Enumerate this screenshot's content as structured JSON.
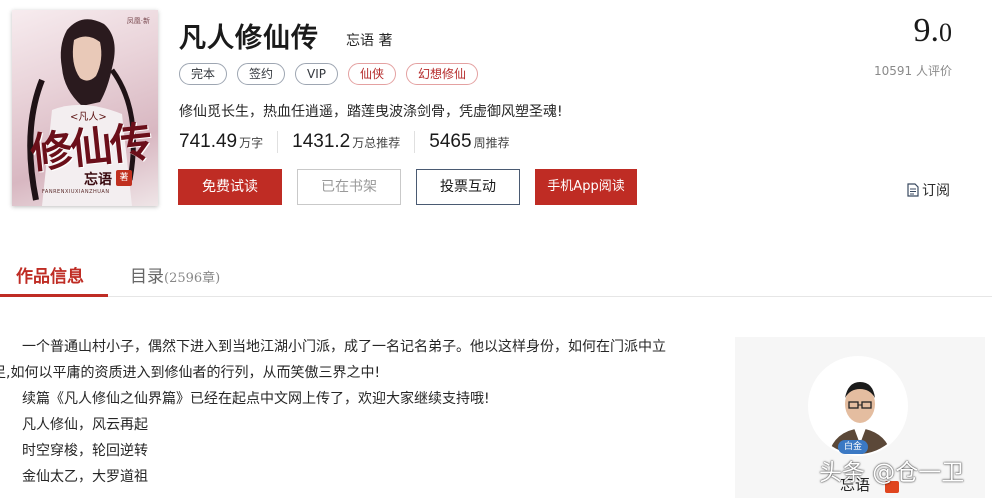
{
  "cover": {
    "title_art": "修仙传",
    "title_sub": "<凡人>",
    "author_art": "忘语",
    "seal": "著",
    "pinyin": "FANRENXIUXIANZHUAN",
    "corner_mark": "凤凰·新"
  },
  "book": {
    "title": "凡人修仙传",
    "author": "忘语 著",
    "tags": [
      "完本",
      "签约",
      "VIP",
      "仙侠",
      "幻想修仙"
    ],
    "intro": "修仙觅长生，热血任逍遥，踏莲曳波涤剑骨，凭虚御风塑圣魂!",
    "stats": [
      {
        "num": "741.49",
        "unit": "万字"
      },
      {
        "num": "1431.2",
        "unit": "万总推荐"
      },
      {
        "num": "5465",
        "unit": "周推荐"
      }
    ]
  },
  "buttons": {
    "read": "免费试读",
    "shelf": "已在书架",
    "vote": "投票互动",
    "app": "手机App阅读",
    "subscribe": "订阅"
  },
  "rating": {
    "score_int": "9.",
    "score_dec": "0",
    "count": "10591",
    "count_label": "人评价"
  },
  "tabs": {
    "info": "作品信息",
    "toc": "目录",
    "toc_count": "(2596章)"
  },
  "description": [
    "一个普通山村小子，偶然下进入到当地江湖小门派，成了一名记名弟子。他以这样身份，如何在门派中立",
    "足,如何以平庸的资质进入到修仙者的行列，从而笑傲三界之中!",
    "续篇《凡人修仙之仙界篇》已经在起点中文网上传了，欢迎大家继续支持哦!",
    "凡人修仙，风云再起",
    "时空穿梭，轮回逆转",
    "金仙太乙，大罗道祖"
  ],
  "author_card": {
    "badge": "白金",
    "name": "忘语"
  },
  "watermark": "头条 @仓一卫",
  "colors": {
    "accent": "#bf2c24",
    "tag_border": "#9ea6b2",
    "tag_red": "#b52a2a"
  }
}
